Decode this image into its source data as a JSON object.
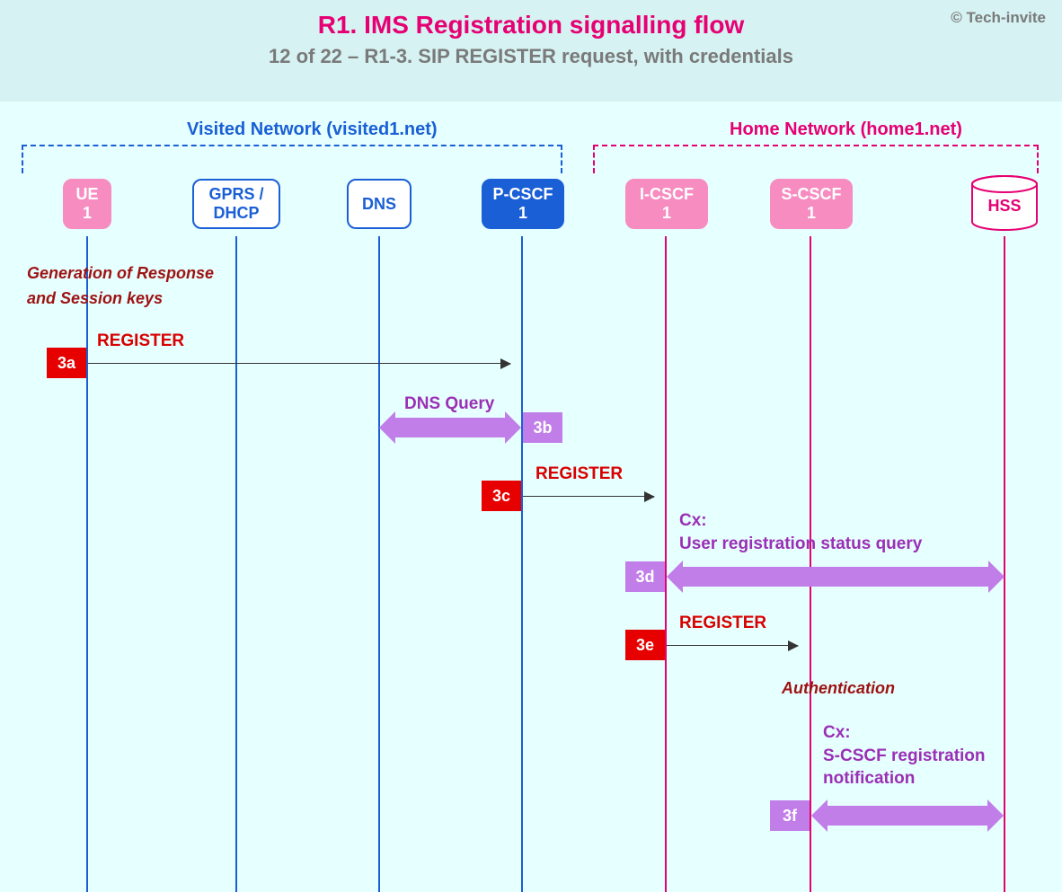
{
  "header": {
    "copyright": "© Tech-invite",
    "title": "R1. IMS Registration signalling flow",
    "subtitle": "12 of 22 – R1-3. SIP REGISTER request, with credentials"
  },
  "networks": {
    "visited": {
      "label": "Visited Network (visited1.net)"
    },
    "home": {
      "label": "Home Network (home1.net)"
    }
  },
  "nodes": {
    "ue1": "UE\n1",
    "gprs": "GPRS /\nDHCP",
    "dns": "DNS",
    "pcscf1": "P-CSCF\n1",
    "icscf1": "I-CSCF\n1",
    "scscf1": "S-CSCF\n1",
    "hss": "HSS"
  },
  "comments": {
    "genresp": "Generation of Response\nand Session keys",
    "auth": "Authentication"
  },
  "steps": {
    "s3a": {
      "badge": "3a",
      "label": "REGISTER"
    },
    "s3b": {
      "badge": "3b",
      "label": "DNS Query"
    },
    "s3c": {
      "badge": "3c",
      "label": "REGISTER"
    },
    "s3d": {
      "badge": "3d",
      "label": "Cx:\nUser registration status query"
    },
    "s3e": {
      "badge": "3e",
      "label": "REGISTER"
    },
    "s3f": {
      "badge": "3f",
      "label": "Cx:\nS-CSCF registration\nnotification"
    }
  }
}
